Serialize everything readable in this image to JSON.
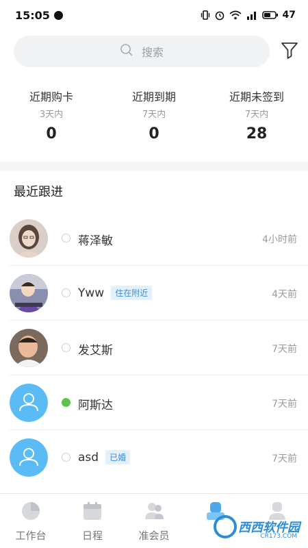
{
  "status_bar": {
    "time": "15:05",
    "battery": "47"
  },
  "search": {
    "placeholder": "搜索"
  },
  "stats": [
    {
      "title": "近期购卡",
      "sub": "3天内",
      "value": "0"
    },
    {
      "title": "近期到期",
      "sub": "7天内",
      "value": "0"
    },
    {
      "title": "近期未签到",
      "sub": "7天内",
      "value": "28"
    }
  ],
  "section": {
    "title": "最近跟进"
  },
  "contacts": [
    {
      "name": "蒋泽敏",
      "tag": "",
      "time": "4小时前",
      "active": false,
      "avatar": "photo-woman"
    },
    {
      "name": "Yww",
      "tag": "住在附近",
      "time": "4天前",
      "active": false,
      "avatar": "photo-baby"
    },
    {
      "name": "发艾斯",
      "tag": "",
      "time": "7天前",
      "active": false,
      "avatar": "photo-man"
    },
    {
      "name": "阿斯达",
      "tag": "",
      "time": "7天前",
      "active": true,
      "avatar": "default-user-icon"
    },
    {
      "name": "asd",
      "tag": "已婚",
      "time": "7天前",
      "active": false,
      "avatar": "default-user-icon"
    }
  ],
  "bottom_nav": [
    {
      "label": "工作台",
      "icon": "pie-chart-icon",
      "active": false
    },
    {
      "label": "日程",
      "icon": "calendar-icon",
      "active": false
    },
    {
      "label": "准会员",
      "icon": "users-icon",
      "active": false
    },
    {
      "label": "",
      "icon": "vip-icon",
      "active": true
    },
    {
      "label": "",
      "icon": "user-icon",
      "active": false
    }
  ],
  "watermark": {
    "brand": "西西软件园",
    "url": "CR173.COM"
  },
  "colors": {
    "accent": "#3fa2e8",
    "avatar_default": "#5bbcf5",
    "active_dot": "#5cc34a",
    "tag_bg": "#e4f1fd",
    "tag_text": "#3a8cd8"
  }
}
